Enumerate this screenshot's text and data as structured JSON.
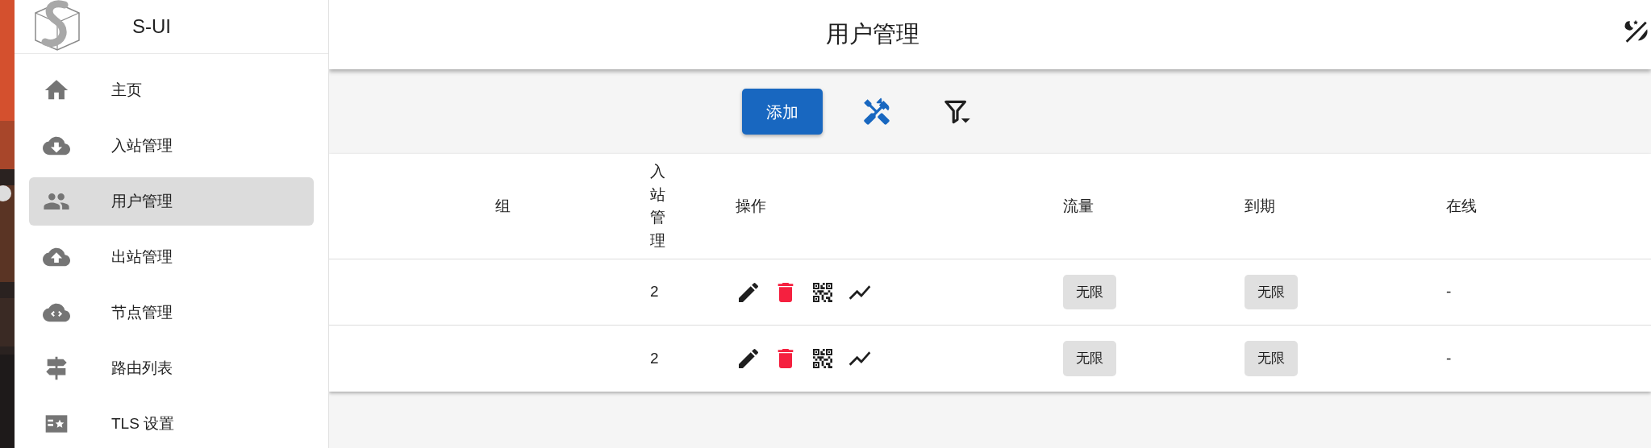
{
  "app": {
    "name": "S-UI"
  },
  "sidebar": {
    "items": [
      {
        "label": "主页",
        "selected": false
      },
      {
        "label": "入站管理",
        "selected": false
      },
      {
        "label": "用户管理",
        "selected": true
      },
      {
        "label": "出站管理",
        "selected": false
      },
      {
        "label": "节点管理",
        "selected": false
      },
      {
        "label": "路由列表",
        "selected": false
      },
      {
        "label": "TLS 设置",
        "selected": false
      }
    ]
  },
  "header": {
    "title": "用户管理"
  },
  "toolbar": {
    "add_button": "添加"
  },
  "table": {
    "columns": [
      "组",
      "入站管理",
      "操作",
      "流量",
      "到期",
      "在线"
    ],
    "rows": [
      {
        "inbounds": "2",
        "traffic": "无限",
        "expiry": "无限",
        "online": "-"
      },
      {
        "inbounds": "2",
        "traffic": "无限",
        "expiry": "无限",
        "online": "-"
      }
    ]
  }
}
